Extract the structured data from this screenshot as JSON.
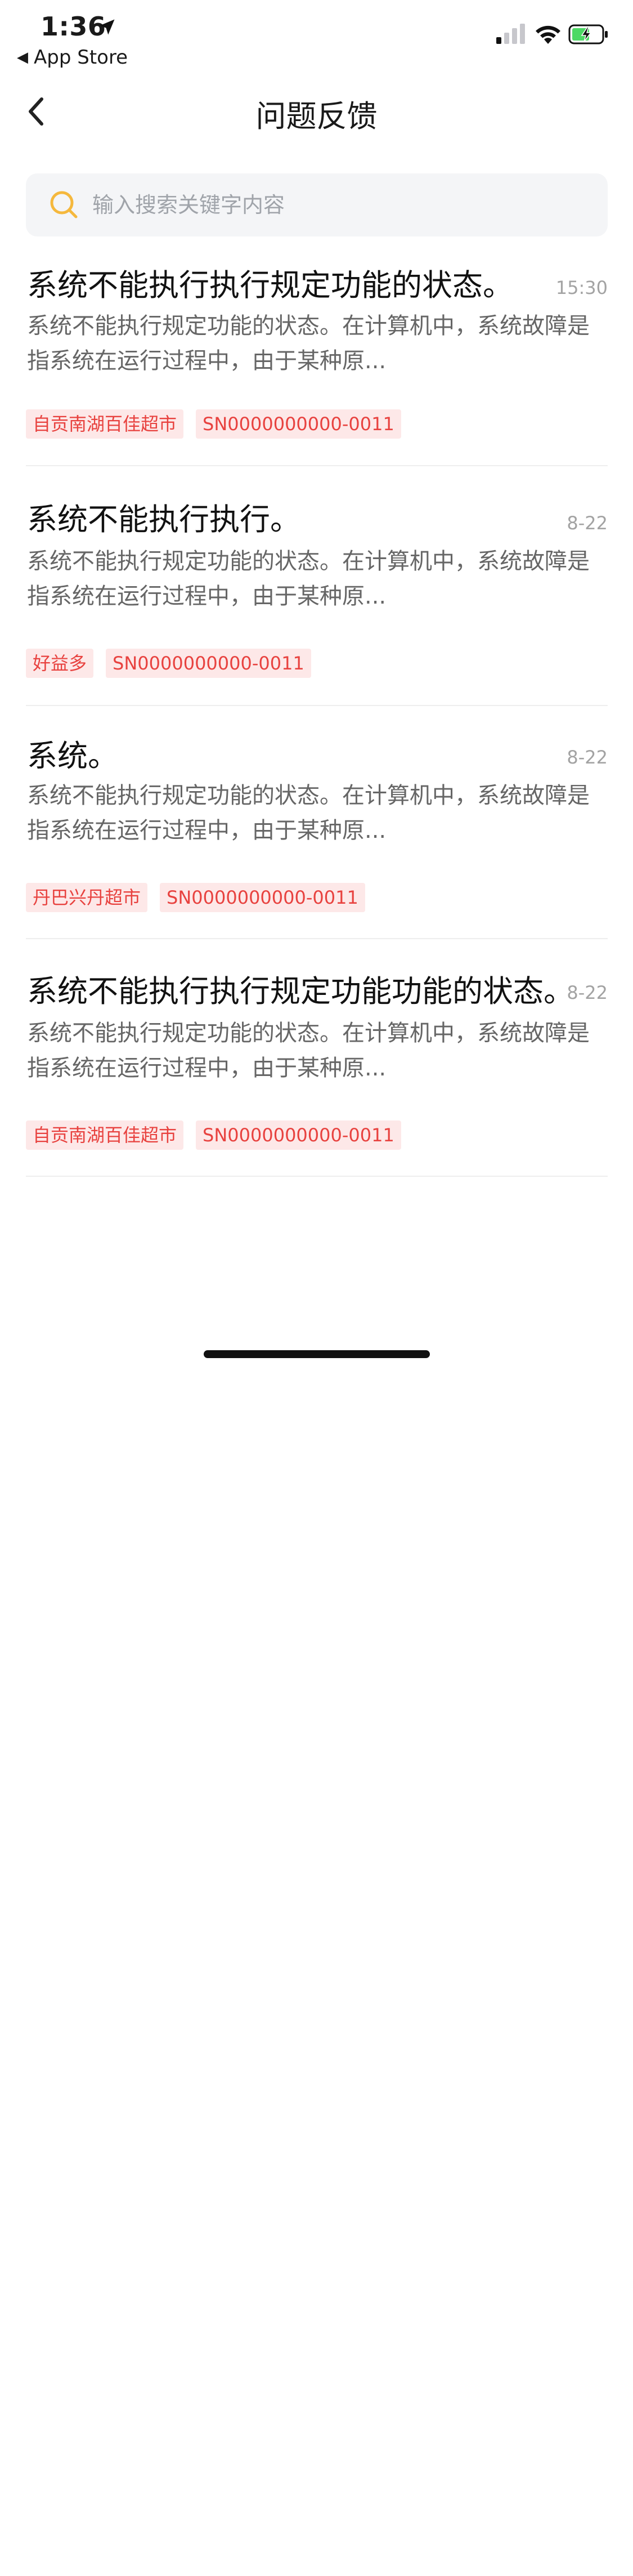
{
  "status_bar": {
    "time": "1:36",
    "back_app_label": "App Store"
  },
  "nav": {
    "title": "问题反馈"
  },
  "search": {
    "placeholder": "输入搜索关键字内容"
  },
  "feedback_items": [
    {
      "title": "系统不能执行执行规定功能的状态。",
      "time": "15:30",
      "description": "系统不能执行规定功能的状态。在计算机中，系统故障是指系统在运行过程中，由于某种原...",
      "store_tag": "自贡南湖百佳超市",
      "serial_tag": "SN0000000000-0011"
    },
    {
      "title": "系统不能执行执行。",
      "time": "8-22",
      "description": "系统不能执行规定功能的状态。在计算机中，系统故障是指系统在运行过程中，由于某种原...",
      "store_tag": "好益多",
      "serial_tag": "SN0000000000-0011"
    },
    {
      "title": "系统。",
      "time": "8-22",
      "description": "系统不能执行规定功能的状态。在计算机中，系统故障是指系统在运行过程中，由于某种原...",
      "store_tag": "丹巴兴丹超市",
      "serial_tag": "SN0000000000-0011"
    },
    {
      "title": "系统不能执行执行规定功能功能的状态。",
      "time": "8-22",
      "description": "系统不能执行规定功能的状态。在计算机中，系统故障是指系统在运行过程中，由于某种原...",
      "store_tag": "自贡南湖百佳超市",
      "serial_tag": "SN0000000000-0011"
    }
  ],
  "colors": {
    "tag_text": "#e8423f",
    "tag_bg": "#fde8e8",
    "search_icon": "#f5b83d",
    "battery_fill": "#4cd964"
  },
  "icons": {
    "location": "location-arrow-icon",
    "signal": "cellular-signal-icon",
    "wifi": "wifi-icon",
    "battery": "battery-charging-icon",
    "back": "chevron-left-icon",
    "search": "search-icon"
  }
}
